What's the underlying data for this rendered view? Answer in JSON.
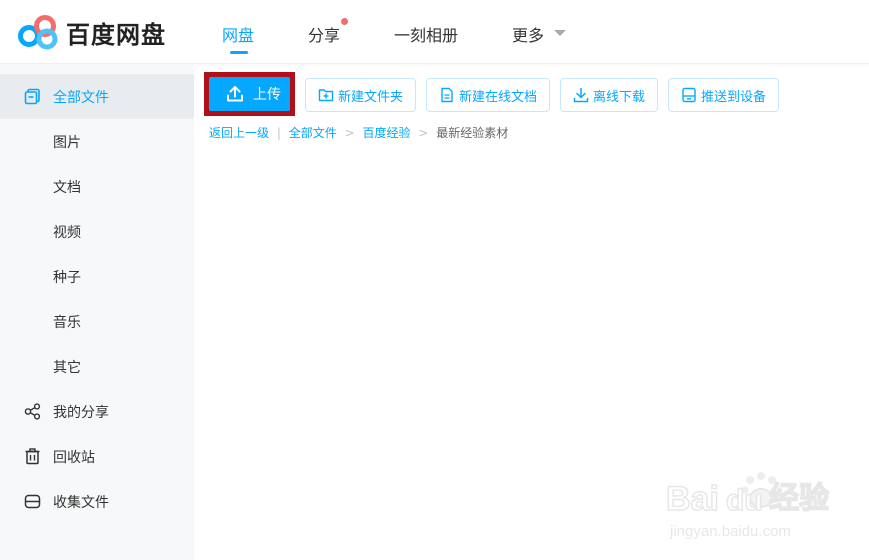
{
  "app": {
    "logo_text": "百度网盘",
    "brand_color": "#06a7ff"
  },
  "nav": {
    "items": [
      {
        "label": "网盘",
        "active": true
      },
      {
        "label": "分享",
        "badge": "red-dot"
      },
      {
        "label": "一刻相册"
      },
      {
        "label": "更多",
        "icon": "caret-down-icon"
      }
    ]
  },
  "sidebar": {
    "items": [
      {
        "label": "全部文件",
        "icon": "folder-icon",
        "active": true
      },
      {
        "label": "图片"
      },
      {
        "label": "文档"
      },
      {
        "label": "视频"
      },
      {
        "label": "种子"
      },
      {
        "label": "音乐"
      },
      {
        "label": "其它"
      },
      {
        "label": "我的分享",
        "icon": "share-icon"
      },
      {
        "label": "回收站",
        "icon": "trash-icon"
      },
      {
        "label": "收集文件",
        "icon": "collect-icon"
      }
    ]
  },
  "toolbar": {
    "upload_label": "上传",
    "new_folder_label": "新建文件夹",
    "new_doc_label": "新建在线文档",
    "offline_download_label": "离线下载",
    "push_device_label": "推送到设备",
    "highlight_color": "#b0101a"
  },
  "breadcrumb": {
    "back": "返回上一级",
    "items": [
      "全部文件",
      "百度经验"
    ],
    "current": "最新经验素材"
  },
  "watermark": {
    "brand": "Bai du 经验",
    "url": "jingyan.baidu.com"
  }
}
